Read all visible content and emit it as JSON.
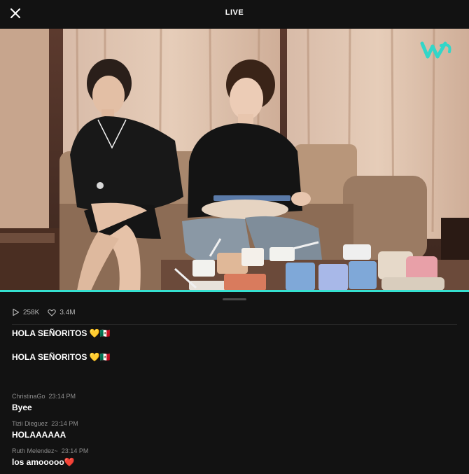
{
  "header": {
    "title": "LIVE"
  },
  "player": {
    "progress": 1.0,
    "accent_color": "#35e0d0",
    "brand_logo": "weverse-logo"
  },
  "stats": {
    "views": "258K",
    "likes": "3.4M"
  },
  "pinned_messages": [
    {
      "text": "HOLA SEÑORITOS 💛🇲🇽"
    },
    {
      "text": "HOLA SEÑORITOS 💛🇲🇽"
    }
  ],
  "comments": [
    {
      "user": "ChristinaGo",
      "time": "23:14 PM",
      "text": "Byee"
    },
    {
      "user": "Tizii Dieguez",
      "time": "23:14 PM",
      "text": "HOLAAAAAA"
    },
    {
      "user": "Ruth Melendez~",
      "time": "23:14 PM",
      "text": "los amooooo❤️"
    }
  ]
}
